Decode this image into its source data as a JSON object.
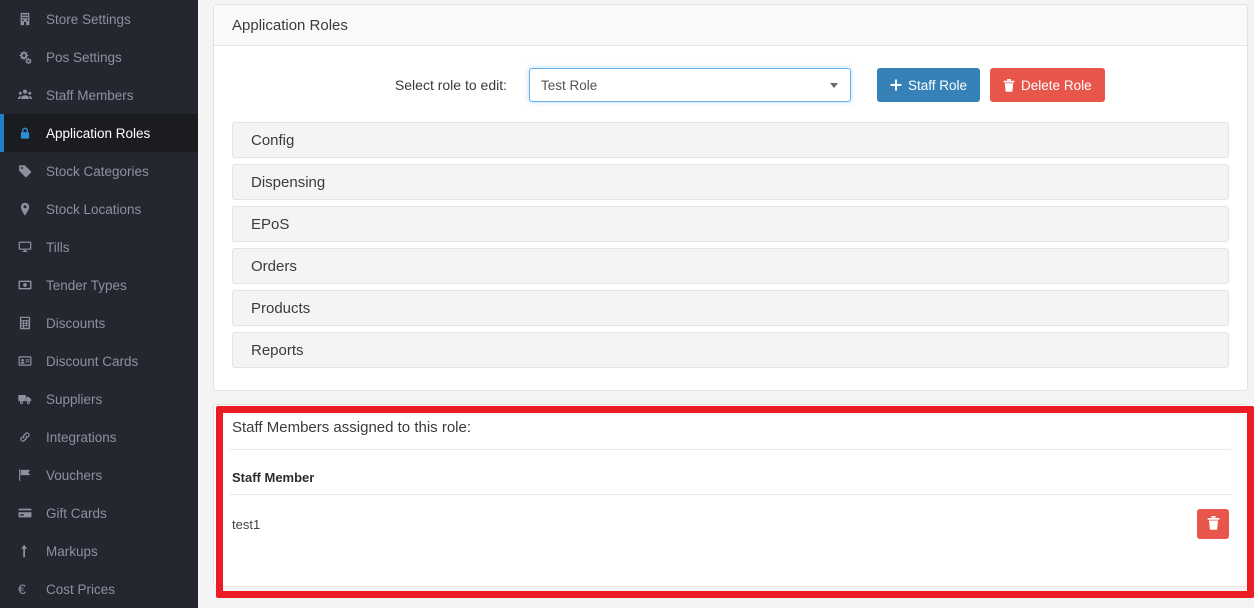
{
  "sidebar": {
    "items": [
      {
        "label": "Store Settings",
        "icon": "building-icon",
        "active": false
      },
      {
        "label": "Pos Settings",
        "icon": "gears-icon",
        "active": false
      },
      {
        "label": "Staff Members",
        "icon": "users-icon",
        "active": false
      },
      {
        "label": "Application Roles",
        "icon": "lock-icon",
        "active": true
      },
      {
        "label": "Stock Categories",
        "icon": "tag-icon",
        "active": false
      },
      {
        "label": "Stock Locations",
        "icon": "map-marker-icon",
        "active": false
      },
      {
        "label": "Tills",
        "icon": "desktop-icon",
        "active": false
      },
      {
        "label": "Tender Types",
        "icon": "money-icon",
        "active": false
      },
      {
        "label": "Discounts",
        "icon": "calculator-icon",
        "active": false
      },
      {
        "label": "Discount Cards",
        "icon": "id-card-icon",
        "active": false
      },
      {
        "label": "Suppliers",
        "icon": "truck-icon",
        "active": false
      },
      {
        "label": "Integrations",
        "icon": "chain-link-icon",
        "active": false
      },
      {
        "label": "Vouchers",
        "icon": "flag-icon",
        "active": false
      },
      {
        "label": "Gift Cards",
        "icon": "credit-card-icon",
        "active": false
      },
      {
        "label": "Markups",
        "icon": "arrow-up-icon",
        "active": false
      },
      {
        "label": "Cost Prices",
        "icon": "euro-icon",
        "active": false
      }
    ]
  },
  "panel": {
    "title": "Application Roles",
    "select_label": "Select role to edit:",
    "select_value": "Test Role",
    "select_options": [
      "Test Role"
    ],
    "add_button": "Staff Role",
    "add_button_icon": "plus-icon",
    "delete_button": "Delete Role",
    "delete_button_icon": "trash-icon"
  },
  "accordion": {
    "sections": [
      {
        "label": "Config"
      },
      {
        "label": "Dispensing"
      },
      {
        "label": "EPoS"
      },
      {
        "label": "Orders"
      },
      {
        "label": "Products"
      },
      {
        "label": "Reports"
      }
    ]
  },
  "staff": {
    "title": "Staff Members assigned to this role:",
    "columns": [
      "Staff Member",
      ""
    ],
    "rows": [
      {
        "name": "test1",
        "action_icon": "trash-icon"
      }
    ]
  },
  "colors": {
    "sidebar_bg": "#242730",
    "sidebar_active_bg": "#1b1c20",
    "accent_blue": "#2180c4",
    "primary_button": "#3581b8",
    "danger_button": "#e8554a",
    "highlight_border": "#ec1c24",
    "page_bg": "#f4f4f4"
  }
}
